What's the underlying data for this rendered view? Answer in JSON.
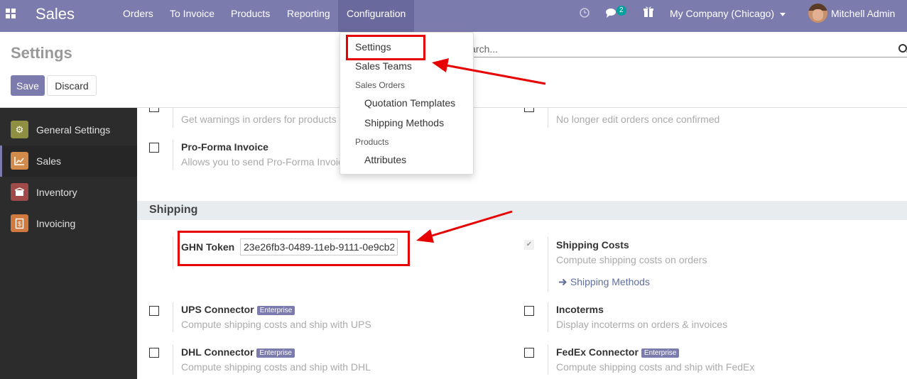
{
  "navbar": {
    "brand": "Sales",
    "menu": [
      "Orders",
      "To Invoice",
      "Products",
      "Reporting",
      "Configuration"
    ],
    "messages_count": "2",
    "company": "My Company (Chicago)",
    "user": "Mitchell Admin",
    "icons": [
      "apps-icon",
      "clock-icon",
      "chat-icon",
      "gift-icon"
    ]
  },
  "control_panel": {
    "title": "Settings",
    "search_placeholder": "Search...",
    "save_label": "Save",
    "discard_label": "Discard"
  },
  "dropdown": {
    "settings": "Settings",
    "sales_teams": "Sales Teams",
    "sales_orders_header": "Sales Orders",
    "quotation_templates": "Quotation Templates",
    "shipping_methods": "Shipping Methods",
    "products_header": "Products",
    "attributes": "Attributes"
  },
  "sidebar": {
    "items": [
      {
        "label": "General Settings",
        "icon": "gear-icon",
        "color": "#8f8f41"
      },
      {
        "label": "Sales",
        "icon": "chart-icon",
        "color": "#d28a4b"
      },
      {
        "label": "Inventory",
        "icon": "box-icon",
        "color": "#a04a4a"
      },
      {
        "label": "Invoicing",
        "icon": "invoice-icon",
        "color": "#d07a40"
      }
    ]
  },
  "settings_top": {
    "warnings_desc": "Get warnings in orders for products",
    "lock_desc": "No longer edit orders once confirmed",
    "proforma_title": "Pro-Forma Invoice",
    "proforma_desc": "Allows you to send Pro-Forma Invoice"
  },
  "shipping": {
    "section_title": "Shipping",
    "ghn_label": "GHN Token",
    "ghn_value": "23e26fb3-0489-11eb-9111-0e9cb2",
    "shipping_costs_title": "Shipping Costs",
    "shipping_costs_desc": "Compute shipping costs on orders",
    "shipping_methods_link": "Shipping Methods",
    "enterprise_badge": "Enterprise",
    "ups_title": "UPS Connector",
    "ups_desc": "Compute shipping costs and ship with UPS",
    "incoterms_title": "Incoterms",
    "incoterms_desc": "Display incoterms on orders & invoices",
    "dhl_title": "DHL Connector",
    "dhl_desc": "Compute shipping costs and ship with DHL",
    "fedex_title": "FedEx Connector",
    "fedex_desc": "Compute shipping costs and ship with FedEx"
  },
  "colors": {
    "brand": "#7c7bad",
    "annotation": "#e60000",
    "sidebar_bg": "#2c2c2c"
  }
}
